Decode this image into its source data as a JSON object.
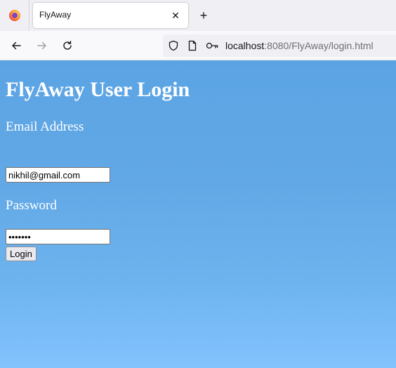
{
  "browser": {
    "tab_title": "FlyAway",
    "new_tab_symbol": "+",
    "close_symbol": "✕",
    "url_host": "localhost",
    "url_rest": ":8080/FlyAway/login.html",
    "icons": [
      "firefox-logo-icon",
      "close-icon",
      "plus-icon",
      "back-arrow-icon",
      "forward-arrow-icon",
      "reload-icon",
      "shield-icon",
      "page-icon",
      "key-icon"
    ]
  },
  "page": {
    "heading": "FlyAway User Login",
    "email_label": "Email Address",
    "email_value": "nikhil@gmail.com",
    "password_label": "Password",
    "password_value": "1234567",
    "login_button": "Login",
    "background_color": "#62a8e6",
    "text_color": "#ffffff"
  }
}
